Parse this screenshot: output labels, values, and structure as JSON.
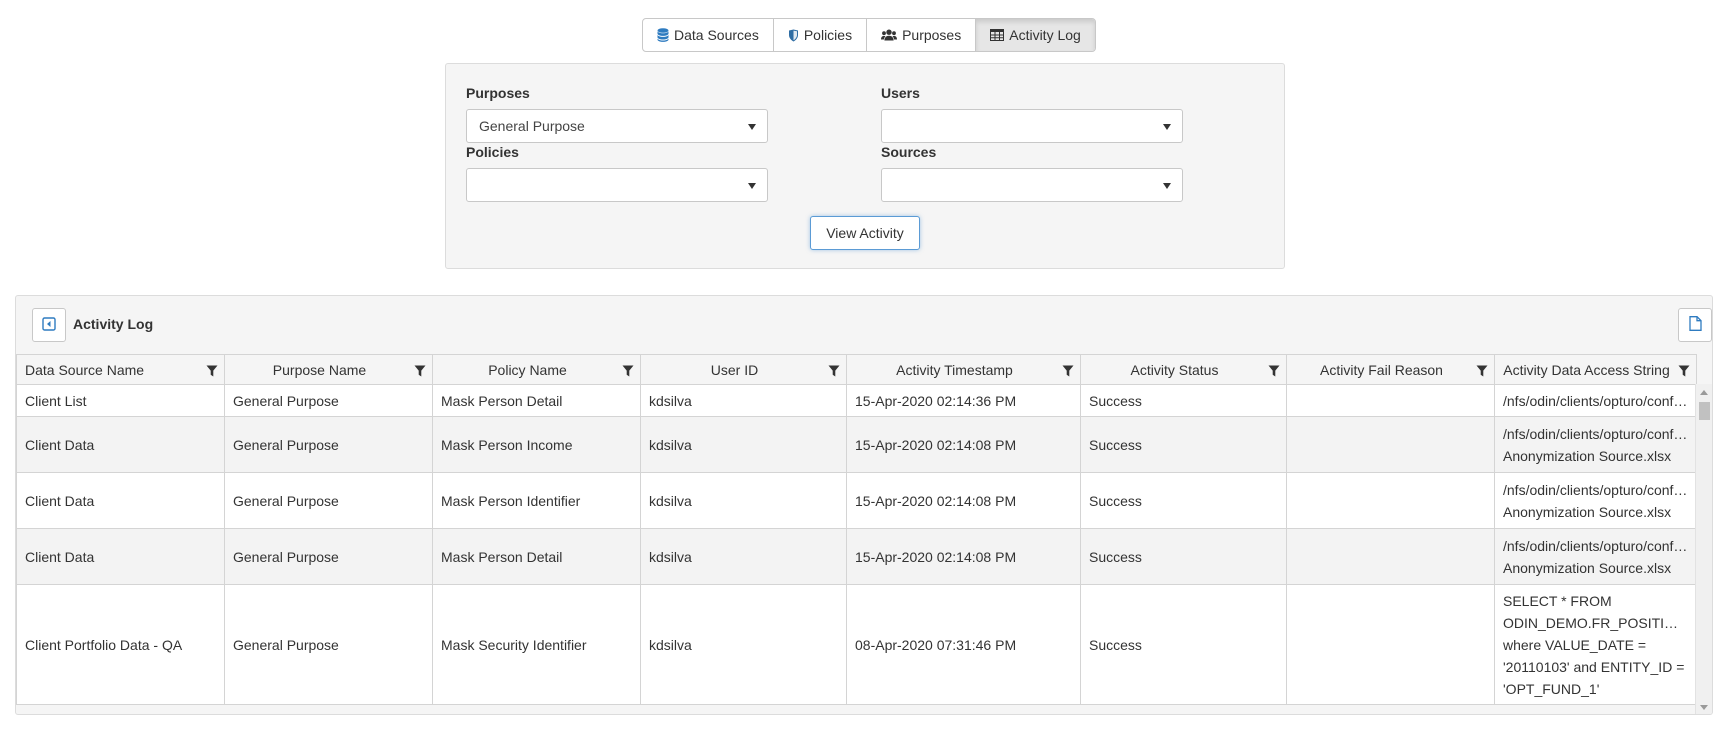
{
  "tabs": [
    {
      "label": "Data Sources",
      "icon": "database-icon"
    },
    {
      "label": "Policies",
      "icon": "shield-icon"
    },
    {
      "label": "Purposes",
      "icon": "users-icon"
    },
    {
      "label": "Activity Log",
      "icon": "table-icon",
      "active": true
    }
  ],
  "filters": {
    "purposes_label": "Purposes",
    "purposes_value": "General Purpose",
    "users_label": "Users",
    "users_value": "",
    "policies_label": "Policies",
    "policies_value": "",
    "sources_label": "Sources",
    "sources_value": "",
    "view_button": "View Activity"
  },
  "log": {
    "title": "Activity Log",
    "columns": [
      "Data Source Name",
      "Purpose Name",
      "Policy Name",
      "User ID",
      "Activity Timestamp",
      "Activity Status",
      "Activity Fail Reason",
      "Activity Data Access String"
    ],
    "rows": [
      [
        "Client List",
        "General Purpose",
        "Mask Person Detail",
        "kdsilva",
        "15-Apr-2020 02:14:36 PM",
        "Success",
        "",
        [
          "/nfs/odin/clients/opturo/conf…"
        ]
      ],
      [
        "Client Data",
        "General Purpose",
        "Mask Person Income",
        "kdsilva",
        "15-Apr-2020 02:14:08 PM",
        "Success",
        "",
        [
          "/nfs/odin/clients/opturo/conf…",
          "Anonymization Source.xlsx"
        ]
      ],
      [
        "Client Data",
        "General Purpose",
        "Mask Person Identifier",
        "kdsilva",
        "15-Apr-2020 02:14:08 PM",
        "Success",
        "",
        [
          "/nfs/odin/clients/opturo/conf…",
          "Anonymization Source.xlsx"
        ]
      ],
      [
        "Client Data",
        "General Purpose",
        "Mask Person Detail",
        "kdsilva",
        "15-Apr-2020 02:14:08 PM",
        "Success",
        "",
        [
          "/nfs/odin/clients/opturo/conf…",
          "Anonymization Source.xlsx"
        ]
      ],
      [
        "Client Portfolio Data - QA",
        "General Purpose",
        "Mask Security Identifier",
        "kdsilva",
        "08-Apr-2020 07:31:46 PM",
        "Success",
        "",
        [
          "SELECT * FROM",
          "ODIN_DEMO.FR_POSITIO…",
          "where VALUE_DATE =",
          "'20110103' and ENTITY_ID =",
          "'OPT_FUND_1'"
        ]
      ]
    ]
  },
  "colors": {
    "accent": "#2e7bc0",
    "panel_bg": "#f5f5f5",
    "border": "#d4d4d4"
  }
}
